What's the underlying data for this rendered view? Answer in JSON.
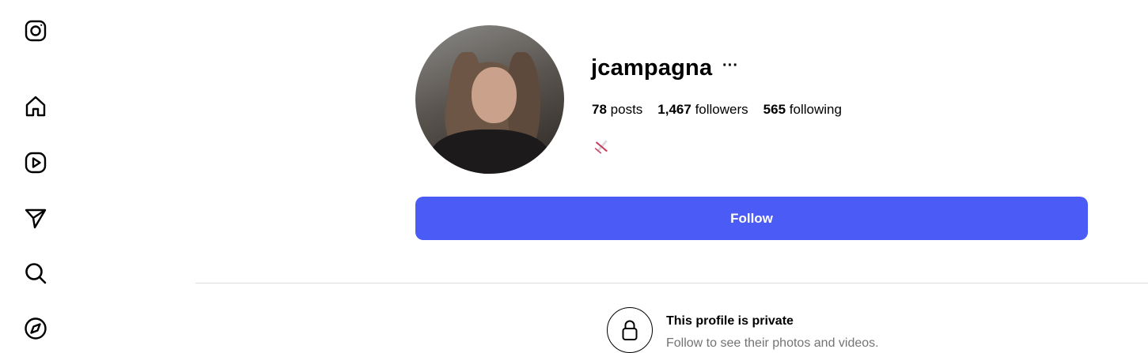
{
  "sidebar": {
    "items": [
      {
        "icon": "instagram-logo-icon"
      },
      {
        "icon": "home-icon"
      },
      {
        "icon": "reels-icon"
      },
      {
        "icon": "messages-icon"
      },
      {
        "icon": "search-icon"
      },
      {
        "icon": "explore-icon"
      }
    ]
  },
  "profile": {
    "username": "jcampagna",
    "more": "···",
    "posts_count": "78",
    "posts_label": "posts",
    "followers_count": "1,467",
    "followers_label": "followers",
    "following_count": "565",
    "following_label": "following",
    "bio_icon": "airplane-emoji"
  },
  "follow_button": {
    "label": "Follow",
    "color": "#4a5cf5"
  },
  "private_notice": {
    "title": "This profile is private",
    "subtitle": "Follow to see their photos and videos."
  }
}
